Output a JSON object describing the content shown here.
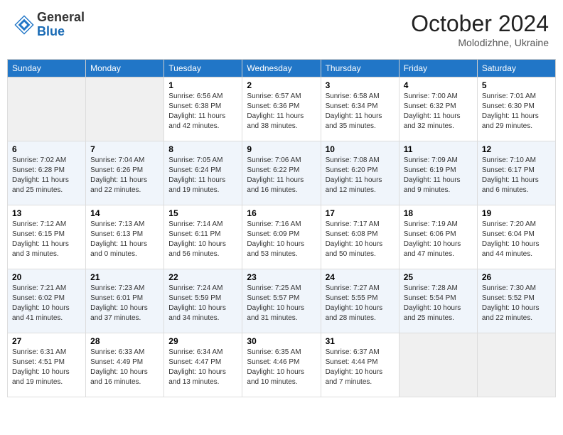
{
  "header": {
    "logo_general": "General",
    "logo_blue": "Blue",
    "month_year": "October 2024",
    "location": "Molodizhne, Ukraine"
  },
  "days_of_week": [
    "Sunday",
    "Monday",
    "Tuesday",
    "Wednesday",
    "Thursday",
    "Friday",
    "Saturday"
  ],
  "weeks": [
    [
      {
        "day": "",
        "sunrise": "",
        "sunset": "",
        "daylight": ""
      },
      {
        "day": "",
        "sunrise": "",
        "sunset": "",
        "daylight": ""
      },
      {
        "day": "1",
        "sunrise": "Sunrise: 6:56 AM",
        "sunset": "Sunset: 6:38 PM",
        "daylight": "Daylight: 11 hours and 42 minutes."
      },
      {
        "day": "2",
        "sunrise": "Sunrise: 6:57 AM",
        "sunset": "Sunset: 6:36 PM",
        "daylight": "Daylight: 11 hours and 38 minutes."
      },
      {
        "day": "3",
        "sunrise": "Sunrise: 6:58 AM",
        "sunset": "Sunset: 6:34 PM",
        "daylight": "Daylight: 11 hours and 35 minutes."
      },
      {
        "day": "4",
        "sunrise": "Sunrise: 7:00 AM",
        "sunset": "Sunset: 6:32 PM",
        "daylight": "Daylight: 11 hours and 32 minutes."
      },
      {
        "day": "5",
        "sunrise": "Sunrise: 7:01 AM",
        "sunset": "Sunset: 6:30 PM",
        "daylight": "Daylight: 11 hours and 29 minutes."
      }
    ],
    [
      {
        "day": "6",
        "sunrise": "Sunrise: 7:02 AM",
        "sunset": "Sunset: 6:28 PM",
        "daylight": "Daylight: 11 hours and 25 minutes."
      },
      {
        "day": "7",
        "sunrise": "Sunrise: 7:04 AM",
        "sunset": "Sunset: 6:26 PM",
        "daylight": "Daylight: 11 hours and 22 minutes."
      },
      {
        "day": "8",
        "sunrise": "Sunrise: 7:05 AM",
        "sunset": "Sunset: 6:24 PM",
        "daylight": "Daylight: 11 hours and 19 minutes."
      },
      {
        "day": "9",
        "sunrise": "Sunrise: 7:06 AM",
        "sunset": "Sunset: 6:22 PM",
        "daylight": "Daylight: 11 hours and 16 minutes."
      },
      {
        "day": "10",
        "sunrise": "Sunrise: 7:08 AM",
        "sunset": "Sunset: 6:20 PM",
        "daylight": "Daylight: 11 hours and 12 minutes."
      },
      {
        "day": "11",
        "sunrise": "Sunrise: 7:09 AM",
        "sunset": "Sunset: 6:19 PM",
        "daylight": "Daylight: 11 hours and 9 minutes."
      },
      {
        "day": "12",
        "sunrise": "Sunrise: 7:10 AM",
        "sunset": "Sunset: 6:17 PM",
        "daylight": "Daylight: 11 hours and 6 minutes."
      }
    ],
    [
      {
        "day": "13",
        "sunrise": "Sunrise: 7:12 AM",
        "sunset": "Sunset: 6:15 PM",
        "daylight": "Daylight: 11 hours and 3 minutes."
      },
      {
        "day": "14",
        "sunrise": "Sunrise: 7:13 AM",
        "sunset": "Sunset: 6:13 PM",
        "daylight": "Daylight: 11 hours and 0 minutes."
      },
      {
        "day": "15",
        "sunrise": "Sunrise: 7:14 AM",
        "sunset": "Sunset: 6:11 PM",
        "daylight": "Daylight: 10 hours and 56 minutes."
      },
      {
        "day": "16",
        "sunrise": "Sunrise: 7:16 AM",
        "sunset": "Sunset: 6:09 PM",
        "daylight": "Daylight: 10 hours and 53 minutes."
      },
      {
        "day": "17",
        "sunrise": "Sunrise: 7:17 AM",
        "sunset": "Sunset: 6:08 PM",
        "daylight": "Daylight: 10 hours and 50 minutes."
      },
      {
        "day": "18",
        "sunrise": "Sunrise: 7:19 AM",
        "sunset": "Sunset: 6:06 PM",
        "daylight": "Daylight: 10 hours and 47 minutes."
      },
      {
        "day": "19",
        "sunrise": "Sunrise: 7:20 AM",
        "sunset": "Sunset: 6:04 PM",
        "daylight": "Daylight: 10 hours and 44 minutes."
      }
    ],
    [
      {
        "day": "20",
        "sunrise": "Sunrise: 7:21 AM",
        "sunset": "Sunset: 6:02 PM",
        "daylight": "Daylight: 10 hours and 41 minutes."
      },
      {
        "day": "21",
        "sunrise": "Sunrise: 7:23 AM",
        "sunset": "Sunset: 6:01 PM",
        "daylight": "Daylight: 10 hours and 37 minutes."
      },
      {
        "day": "22",
        "sunrise": "Sunrise: 7:24 AM",
        "sunset": "Sunset: 5:59 PM",
        "daylight": "Daylight: 10 hours and 34 minutes."
      },
      {
        "day": "23",
        "sunrise": "Sunrise: 7:25 AM",
        "sunset": "Sunset: 5:57 PM",
        "daylight": "Daylight: 10 hours and 31 minutes."
      },
      {
        "day": "24",
        "sunrise": "Sunrise: 7:27 AM",
        "sunset": "Sunset: 5:55 PM",
        "daylight": "Daylight: 10 hours and 28 minutes."
      },
      {
        "day": "25",
        "sunrise": "Sunrise: 7:28 AM",
        "sunset": "Sunset: 5:54 PM",
        "daylight": "Daylight: 10 hours and 25 minutes."
      },
      {
        "day": "26",
        "sunrise": "Sunrise: 7:30 AM",
        "sunset": "Sunset: 5:52 PM",
        "daylight": "Daylight: 10 hours and 22 minutes."
      }
    ],
    [
      {
        "day": "27",
        "sunrise": "Sunrise: 6:31 AM",
        "sunset": "Sunset: 4:51 PM",
        "daylight": "Daylight: 10 hours and 19 minutes."
      },
      {
        "day": "28",
        "sunrise": "Sunrise: 6:33 AM",
        "sunset": "Sunset: 4:49 PM",
        "daylight": "Daylight: 10 hours and 16 minutes."
      },
      {
        "day": "29",
        "sunrise": "Sunrise: 6:34 AM",
        "sunset": "Sunset: 4:47 PM",
        "daylight": "Daylight: 10 hours and 13 minutes."
      },
      {
        "day": "30",
        "sunrise": "Sunrise: 6:35 AM",
        "sunset": "Sunset: 4:46 PM",
        "daylight": "Daylight: 10 hours and 10 minutes."
      },
      {
        "day": "31",
        "sunrise": "Sunrise: 6:37 AM",
        "sunset": "Sunset: 4:44 PM",
        "daylight": "Daylight: 10 hours and 7 minutes."
      },
      {
        "day": "",
        "sunrise": "",
        "sunset": "",
        "daylight": ""
      },
      {
        "day": "",
        "sunrise": "",
        "sunset": "",
        "daylight": ""
      }
    ]
  ]
}
